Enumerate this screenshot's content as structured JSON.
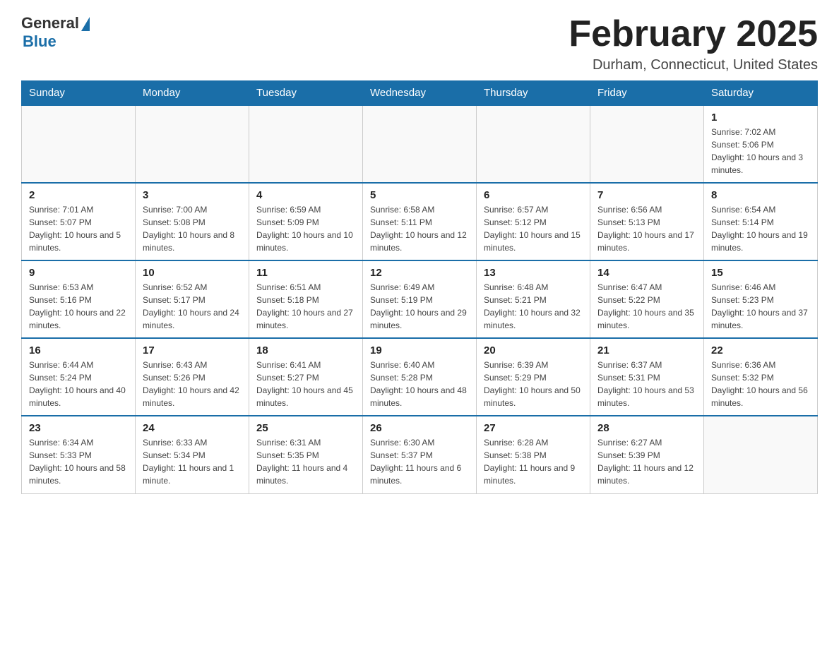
{
  "logo": {
    "general": "General",
    "blue": "Blue"
  },
  "title": "February 2025",
  "location": "Durham, Connecticut, United States",
  "weekdays": [
    "Sunday",
    "Monday",
    "Tuesday",
    "Wednesday",
    "Thursday",
    "Friday",
    "Saturday"
  ],
  "weeks": [
    [
      {
        "day": "",
        "sunrise": "",
        "sunset": "",
        "daylight": ""
      },
      {
        "day": "",
        "sunrise": "",
        "sunset": "",
        "daylight": ""
      },
      {
        "day": "",
        "sunrise": "",
        "sunset": "",
        "daylight": ""
      },
      {
        "day": "",
        "sunrise": "",
        "sunset": "",
        "daylight": ""
      },
      {
        "day": "",
        "sunrise": "",
        "sunset": "",
        "daylight": ""
      },
      {
        "day": "",
        "sunrise": "",
        "sunset": "",
        "daylight": ""
      },
      {
        "day": "1",
        "sunrise": "Sunrise: 7:02 AM",
        "sunset": "Sunset: 5:06 PM",
        "daylight": "Daylight: 10 hours and 3 minutes."
      }
    ],
    [
      {
        "day": "2",
        "sunrise": "Sunrise: 7:01 AM",
        "sunset": "Sunset: 5:07 PM",
        "daylight": "Daylight: 10 hours and 5 minutes."
      },
      {
        "day": "3",
        "sunrise": "Sunrise: 7:00 AM",
        "sunset": "Sunset: 5:08 PM",
        "daylight": "Daylight: 10 hours and 8 minutes."
      },
      {
        "day": "4",
        "sunrise": "Sunrise: 6:59 AM",
        "sunset": "Sunset: 5:09 PM",
        "daylight": "Daylight: 10 hours and 10 minutes."
      },
      {
        "day": "5",
        "sunrise": "Sunrise: 6:58 AM",
        "sunset": "Sunset: 5:11 PM",
        "daylight": "Daylight: 10 hours and 12 minutes."
      },
      {
        "day": "6",
        "sunrise": "Sunrise: 6:57 AM",
        "sunset": "Sunset: 5:12 PM",
        "daylight": "Daylight: 10 hours and 15 minutes."
      },
      {
        "day": "7",
        "sunrise": "Sunrise: 6:56 AM",
        "sunset": "Sunset: 5:13 PM",
        "daylight": "Daylight: 10 hours and 17 minutes."
      },
      {
        "day": "8",
        "sunrise": "Sunrise: 6:54 AM",
        "sunset": "Sunset: 5:14 PM",
        "daylight": "Daylight: 10 hours and 19 minutes."
      }
    ],
    [
      {
        "day": "9",
        "sunrise": "Sunrise: 6:53 AM",
        "sunset": "Sunset: 5:16 PM",
        "daylight": "Daylight: 10 hours and 22 minutes."
      },
      {
        "day": "10",
        "sunrise": "Sunrise: 6:52 AM",
        "sunset": "Sunset: 5:17 PM",
        "daylight": "Daylight: 10 hours and 24 minutes."
      },
      {
        "day": "11",
        "sunrise": "Sunrise: 6:51 AM",
        "sunset": "Sunset: 5:18 PM",
        "daylight": "Daylight: 10 hours and 27 minutes."
      },
      {
        "day": "12",
        "sunrise": "Sunrise: 6:49 AM",
        "sunset": "Sunset: 5:19 PM",
        "daylight": "Daylight: 10 hours and 29 minutes."
      },
      {
        "day": "13",
        "sunrise": "Sunrise: 6:48 AM",
        "sunset": "Sunset: 5:21 PM",
        "daylight": "Daylight: 10 hours and 32 minutes."
      },
      {
        "day": "14",
        "sunrise": "Sunrise: 6:47 AM",
        "sunset": "Sunset: 5:22 PM",
        "daylight": "Daylight: 10 hours and 35 minutes."
      },
      {
        "day": "15",
        "sunrise": "Sunrise: 6:46 AM",
        "sunset": "Sunset: 5:23 PM",
        "daylight": "Daylight: 10 hours and 37 minutes."
      }
    ],
    [
      {
        "day": "16",
        "sunrise": "Sunrise: 6:44 AM",
        "sunset": "Sunset: 5:24 PM",
        "daylight": "Daylight: 10 hours and 40 minutes."
      },
      {
        "day": "17",
        "sunrise": "Sunrise: 6:43 AM",
        "sunset": "Sunset: 5:26 PM",
        "daylight": "Daylight: 10 hours and 42 minutes."
      },
      {
        "day": "18",
        "sunrise": "Sunrise: 6:41 AM",
        "sunset": "Sunset: 5:27 PM",
        "daylight": "Daylight: 10 hours and 45 minutes."
      },
      {
        "day": "19",
        "sunrise": "Sunrise: 6:40 AM",
        "sunset": "Sunset: 5:28 PM",
        "daylight": "Daylight: 10 hours and 48 minutes."
      },
      {
        "day": "20",
        "sunrise": "Sunrise: 6:39 AM",
        "sunset": "Sunset: 5:29 PM",
        "daylight": "Daylight: 10 hours and 50 minutes."
      },
      {
        "day": "21",
        "sunrise": "Sunrise: 6:37 AM",
        "sunset": "Sunset: 5:31 PM",
        "daylight": "Daylight: 10 hours and 53 minutes."
      },
      {
        "day": "22",
        "sunrise": "Sunrise: 6:36 AM",
        "sunset": "Sunset: 5:32 PM",
        "daylight": "Daylight: 10 hours and 56 minutes."
      }
    ],
    [
      {
        "day": "23",
        "sunrise": "Sunrise: 6:34 AM",
        "sunset": "Sunset: 5:33 PM",
        "daylight": "Daylight: 10 hours and 58 minutes."
      },
      {
        "day": "24",
        "sunrise": "Sunrise: 6:33 AM",
        "sunset": "Sunset: 5:34 PM",
        "daylight": "Daylight: 11 hours and 1 minute."
      },
      {
        "day": "25",
        "sunrise": "Sunrise: 6:31 AM",
        "sunset": "Sunset: 5:35 PM",
        "daylight": "Daylight: 11 hours and 4 minutes."
      },
      {
        "day": "26",
        "sunrise": "Sunrise: 6:30 AM",
        "sunset": "Sunset: 5:37 PM",
        "daylight": "Daylight: 11 hours and 6 minutes."
      },
      {
        "day": "27",
        "sunrise": "Sunrise: 6:28 AM",
        "sunset": "Sunset: 5:38 PM",
        "daylight": "Daylight: 11 hours and 9 minutes."
      },
      {
        "day": "28",
        "sunrise": "Sunrise: 6:27 AM",
        "sunset": "Sunset: 5:39 PM",
        "daylight": "Daylight: 11 hours and 12 minutes."
      },
      {
        "day": "",
        "sunrise": "",
        "sunset": "",
        "daylight": ""
      }
    ]
  ]
}
